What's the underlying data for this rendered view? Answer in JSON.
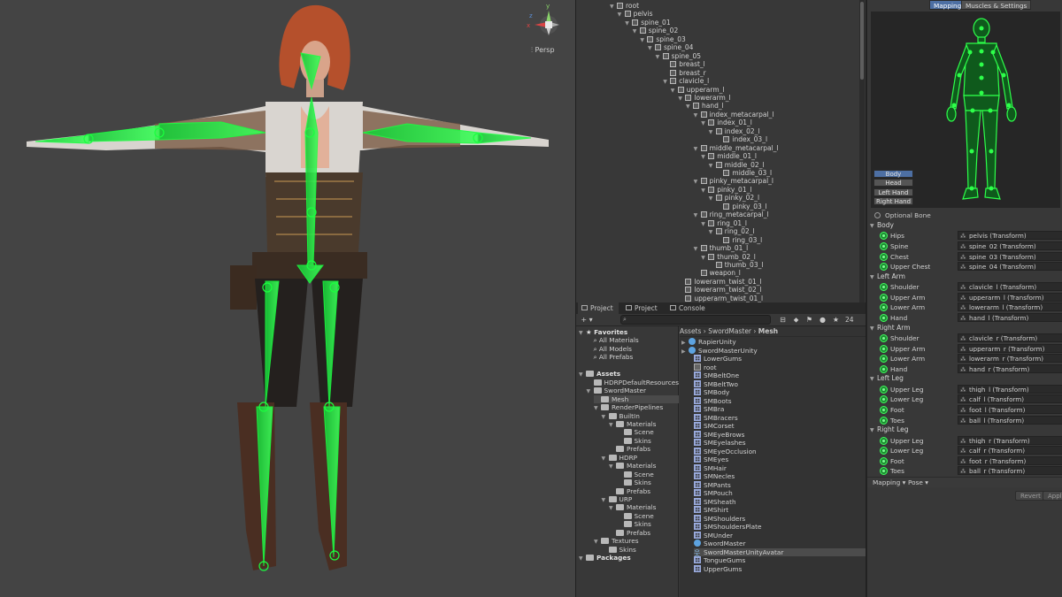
{
  "scene": {
    "persp_label": "⫶ Persp",
    "gizmo_axes": {
      "y": "y",
      "x": "x",
      "z": "z"
    }
  },
  "hierarchy": {
    "items": [
      {
        "label": "root",
        "depth": 0,
        "arrow": true
      },
      {
        "label": "pelvis",
        "depth": 1,
        "arrow": true
      },
      {
        "label": "spine_01",
        "depth": 2,
        "arrow": true
      },
      {
        "label": "spine_02",
        "depth": 3,
        "arrow": true
      },
      {
        "label": "spine_03",
        "depth": 4,
        "arrow": true
      },
      {
        "label": "spine_04",
        "depth": 5,
        "arrow": true
      },
      {
        "label": "spine_05",
        "depth": 6,
        "arrow": true
      },
      {
        "label": "breast_l",
        "depth": 7,
        "arrow": false
      },
      {
        "label": "breast_r",
        "depth": 7,
        "arrow": false
      },
      {
        "label": "clavicle_l",
        "depth": 7,
        "arrow": true
      },
      {
        "label": "upperarm_l",
        "depth": 8,
        "arrow": true
      },
      {
        "label": "lowerarm_l",
        "depth": 9,
        "arrow": true
      },
      {
        "label": "hand_l",
        "depth": 10,
        "arrow": true
      },
      {
        "label": "index_metacarpal_l",
        "depth": 11,
        "arrow": true
      },
      {
        "label": "index_01_l",
        "depth": 12,
        "arrow": true
      },
      {
        "label": "index_02_l",
        "depth": 13,
        "arrow": true
      },
      {
        "label": "index_03_l",
        "depth": 14,
        "arrow": false
      },
      {
        "label": "middle_metacarpal_l",
        "depth": 11,
        "arrow": true
      },
      {
        "label": "middle_01_l",
        "depth": 12,
        "arrow": true
      },
      {
        "label": "middle_02_l",
        "depth": 13,
        "arrow": true
      },
      {
        "label": "middle_03_l",
        "depth": 14,
        "arrow": false
      },
      {
        "label": "pinky_metacarpal_l",
        "depth": 11,
        "arrow": true
      },
      {
        "label": "pinky_01_l",
        "depth": 12,
        "arrow": true
      },
      {
        "label": "pinky_02_l",
        "depth": 13,
        "arrow": true
      },
      {
        "label": "pinky_03_l",
        "depth": 14,
        "arrow": false
      },
      {
        "label": "ring_metacarpal_l",
        "depth": 11,
        "arrow": true
      },
      {
        "label": "ring_01_l",
        "depth": 12,
        "arrow": true
      },
      {
        "label": "ring_02_l",
        "depth": 13,
        "arrow": true
      },
      {
        "label": "ring_03_l",
        "depth": 14,
        "arrow": false
      },
      {
        "label": "thumb_01_l",
        "depth": 11,
        "arrow": true
      },
      {
        "label": "thumb_02_l",
        "depth": 12,
        "arrow": true
      },
      {
        "label": "thumb_03_l",
        "depth": 13,
        "arrow": false
      },
      {
        "label": "weapon_l",
        "depth": 11,
        "arrow": false
      },
      {
        "label": "lowerarm_twist_01_l",
        "depth": 9,
        "arrow": false
      },
      {
        "label": "lowerarm_twist_02_l",
        "depth": 9,
        "arrow": false
      },
      {
        "label": "upperarm_twist_01_l",
        "depth": 9,
        "arrow": false
      }
    ]
  },
  "project": {
    "tabs": [
      {
        "label": "Project",
        "active": true
      },
      {
        "label": "Project",
        "active": false
      },
      {
        "label": "Console",
        "active": false
      }
    ],
    "add_label": "+ ▾",
    "count": "24",
    "tree": [
      {
        "label": "Favorites",
        "depth": 0,
        "arrow": true,
        "bold": true,
        "icon": "star"
      },
      {
        "label": "All Materials",
        "depth": 1,
        "arrow": false,
        "icon": "search"
      },
      {
        "label": "All Models",
        "depth": 1,
        "arrow": false,
        "icon": "search"
      },
      {
        "label": "All Prefabs",
        "depth": 1,
        "arrow": false,
        "icon": "search"
      },
      {
        "label": "",
        "depth": 0,
        "arrow": false,
        "icon": "none"
      },
      {
        "label": "Assets",
        "depth": 0,
        "arrow": true,
        "bold": true,
        "icon": "folder"
      },
      {
        "label": "HDRPDefaultResources",
        "depth": 1,
        "arrow": false,
        "icon": "folder"
      },
      {
        "label": "SwordMaster",
        "depth": 1,
        "arrow": true,
        "icon": "folder"
      },
      {
        "label": "Mesh",
        "depth": 2,
        "arrow": false,
        "icon": "folder",
        "selected": true
      },
      {
        "label": "RenderPipelines",
        "depth": 2,
        "arrow": true,
        "icon": "folder"
      },
      {
        "label": "BuiltIn",
        "depth": 3,
        "arrow": true,
        "icon": "folder"
      },
      {
        "label": "Materials",
        "depth": 4,
        "arrow": true,
        "icon": "folder"
      },
      {
        "label": "Scene",
        "depth": 5,
        "arrow": false,
        "icon": "folder"
      },
      {
        "label": "Skins",
        "depth": 5,
        "arrow": false,
        "icon": "folder"
      },
      {
        "label": "Prefabs",
        "depth": 4,
        "arrow": false,
        "icon": "folder"
      },
      {
        "label": "HDRP",
        "depth": 3,
        "arrow": true,
        "icon": "folder"
      },
      {
        "label": "Materials",
        "depth": 4,
        "arrow": true,
        "icon": "folder"
      },
      {
        "label": "Scene",
        "depth": 5,
        "arrow": false,
        "icon": "folder"
      },
      {
        "label": "Skins",
        "depth": 5,
        "arrow": false,
        "icon": "folder"
      },
      {
        "label": "Prefabs",
        "depth": 4,
        "arrow": false,
        "icon": "folder"
      },
      {
        "label": "URP",
        "depth": 3,
        "arrow": true,
        "icon": "folder"
      },
      {
        "label": "Materials",
        "depth": 4,
        "arrow": true,
        "icon": "folder"
      },
      {
        "label": "Scene",
        "depth": 5,
        "arrow": false,
        "icon": "folder"
      },
      {
        "label": "Skins",
        "depth": 5,
        "arrow": false,
        "icon": "folder"
      },
      {
        "label": "Prefabs",
        "depth": 4,
        "arrow": false,
        "icon": "folder"
      },
      {
        "label": "Textures",
        "depth": 2,
        "arrow": true,
        "icon": "folder"
      },
      {
        "label": "Skins",
        "depth": 3,
        "arrow": false,
        "icon": "folder"
      },
      {
        "label": "Packages",
        "depth": 0,
        "arrow": true,
        "bold": true,
        "icon": "folder"
      }
    ],
    "breadcrumb": [
      "Assets",
      "SwordMaster",
      "Mesh"
    ],
    "list": [
      {
        "label": "RapierUnity",
        "icon": "prefab",
        "arrow": true,
        "indent": 0
      },
      {
        "label": "SwordMasterUnity",
        "icon": "prefab",
        "arrow": true,
        "indent": 0
      },
      {
        "label": "LowerGums",
        "icon": "mesh",
        "indent": 1
      },
      {
        "label": "root",
        "icon": "bone",
        "indent": 1
      },
      {
        "label": "SMBeltOne",
        "icon": "mesh",
        "indent": 1
      },
      {
        "label": "SMBeltTwo",
        "icon": "mesh",
        "indent": 1
      },
      {
        "label": "SMBody",
        "icon": "mesh",
        "indent": 1
      },
      {
        "label": "SMBoots",
        "icon": "mesh",
        "indent": 1
      },
      {
        "label": "SMBra",
        "icon": "mesh",
        "indent": 1
      },
      {
        "label": "SMBracers",
        "icon": "mesh",
        "indent": 1
      },
      {
        "label": "SMCorset",
        "icon": "mesh",
        "indent": 1
      },
      {
        "label": "SMEyeBrows",
        "icon": "mesh",
        "indent": 1
      },
      {
        "label": "SMEyelashes",
        "icon": "mesh",
        "indent": 1
      },
      {
        "label": "SMEyeOcclusion",
        "icon": "mesh",
        "indent": 1
      },
      {
        "label": "SMEyes",
        "icon": "mesh",
        "indent": 1
      },
      {
        "label": "SMHair",
        "icon": "mesh",
        "indent": 1
      },
      {
        "label": "SMNecles",
        "icon": "mesh",
        "indent": 1
      },
      {
        "label": "SMPants",
        "icon": "mesh",
        "indent": 1
      },
      {
        "label": "SMPouch",
        "icon": "mesh",
        "indent": 1
      },
      {
        "label": "SMSheath",
        "icon": "mesh",
        "indent": 1
      },
      {
        "label": "SMShirt",
        "icon": "mesh",
        "indent": 1
      },
      {
        "label": "SMShoulders",
        "icon": "mesh",
        "indent": 1
      },
      {
        "label": "SMShouldersPlate",
        "icon": "mesh",
        "indent": 1
      },
      {
        "label": "SMUnder",
        "icon": "mesh",
        "indent": 1
      },
      {
        "label": "SwordMaster",
        "icon": "prefab",
        "indent": 1
      },
      {
        "label": "SwordMasterUnityAvatar",
        "icon": "avatar",
        "indent": 1,
        "selected": true
      },
      {
        "label": "TongueGums",
        "icon": "mesh",
        "indent": 1
      },
      {
        "label": "UpperGums",
        "icon": "mesh",
        "indent": 1
      }
    ]
  },
  "avatar": {
    "tabs": [
      {
        "label": "Mapping",
        "active": true
      },
      {
        "label": "Muscles & Settings",
        "active": false
      }
    ],
    "parts": [
      {
        "label": "Body",
        "active": true
      },
      {
        "label": "Head",
        "active": false
      },
      {
        "label": "Left Hand",
        "active": false
      },
      {
        "label": "Right Hand",
        "active": false
      }
    ],
    "optional_bone": "Optional Bone",
    "groups": [
      {
        "name": "Body",
        "bones": [
          {
            "name": "Hips",
            "value": "pelvis (Transform)"
          },
          {
            "name": "Spine",
            "value": "spine_02 (Transform)"
          },
          {
            "name": "Chest",
            "value": "spine_03 (Transform)"
          },
          {
            "name": "Upper Chest",
            "value": "spine_04 (Transform)"
          }
        ]
      },
      {
        "name": "Left Arm",
        "bones": [
          {
            "name": "Shoulder",
            "value": "clavicle_l (Transform)"
          },
          {
            "name": "Upper Arm",
            "value": "upperarm_l (Transform)"
          },
          {
            "name": "Lower Arm",
            "value": "lowerarm_l (Transform)"
          },
          {
            "name": "Hand",
            "value": "hand_l (Transform)"
          }
        ]
      },
      {
        "name": "Right Arm",
        "bones": [
          {
            "name": "Shoulder",
            "value": "clavicle_r (Transform)"
          },
          {
            "name": "Upper Arm",
            "value": "upperarm_r (Transform)"
          },
          {
            "name": "Lower Arm",
            "value": "lowerarm_r (Transform)"
          },
          {
            "name": "Hand",
            "value": "hand_r (Transform)"
          }
        ]
      },
      {
        "name": "Left Leg",
        "bones": [
          {
            "name": "Upper Leg",
            "value": "thigh_l (Transform)"
          },
          {
            "name": "Lower Leg",
            "value": "calf_l (Transform)"
          },
          {
            "name": "Foot",
            "value": "foot_l (Transform)"
          },
          {
            "name": "Toes",
            "value": "ball_l (Transform)"
          }
        ]
      },
      {
        "name": "Right Leg",
        "bones": [
          {
            "name": "Upper Leg",
            "value": "thigh_r (Transform)"
          },
          {
            "name": "Lower Leg",
            "value": "calf_r (Transform)"
          },
          {
            "name": "Foot",
            "value": "foot_r (Transform)"
          },
          {
            "name": "Toes",
            "value": "ball_r (Transform)"
          }
        ]
      }
    ],
    "mapping_dropdown": "Mapping ▾",
    "pose_dropdown": "Pose ▾",
    "revert_label": "Revert",
    "apply_label": "Apply"
  },
  "colors": {
    "bone_green": "#2dff4a",
    "accent_blue": "#4d6fa3"
  }
}
